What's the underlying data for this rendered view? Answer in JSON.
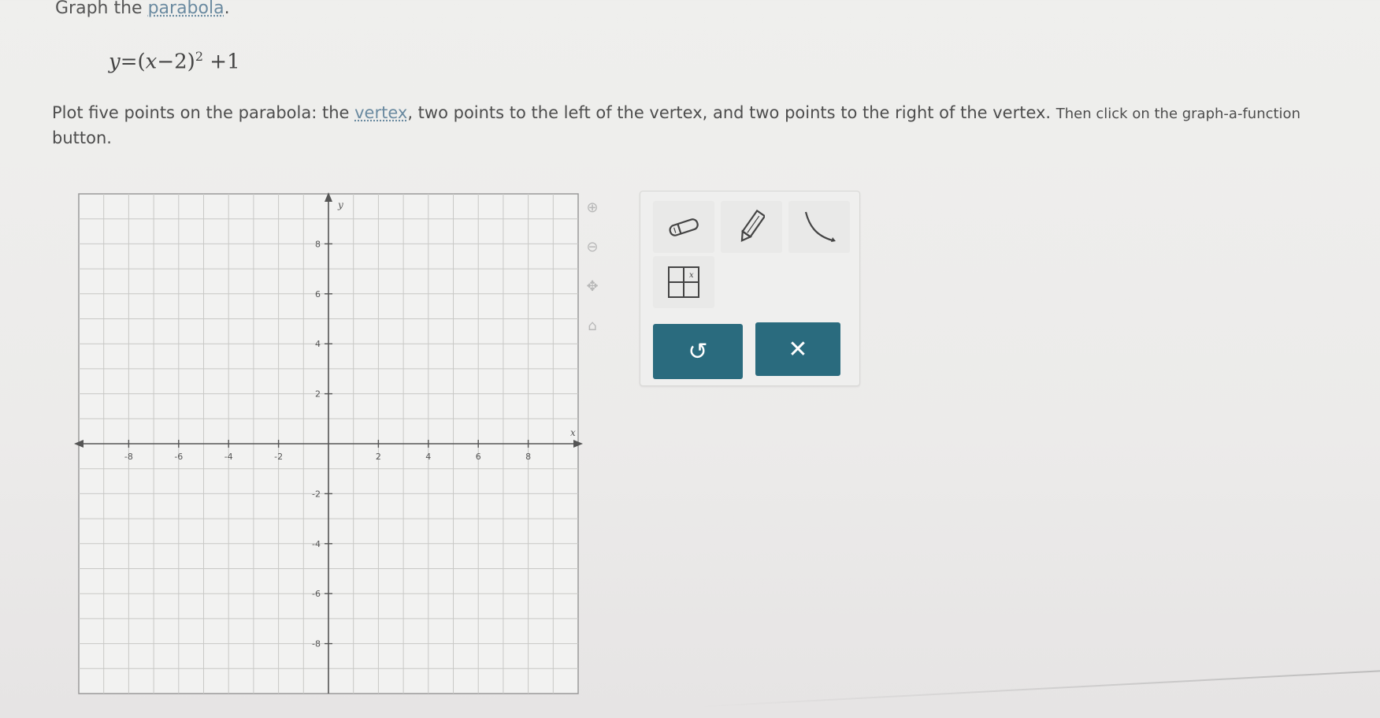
{
  "header": {
    "title_prefix": "Graph the ",
    "title_link": "parabola",
    "title_suffix": "."
  },
  "equation": {
    "lhs": "y",
    "eq": "=",
    "open": "(",
    "var": "x",
    "minus": "−",
    "two": "2",
    "close": ")",
    "exp": "2",
    "plus": "+",
    "one": "1"
  },
  "instructions": {
    "part1": "Plot five points on the parabola: the ",
    "link": "vertex",
    "part2": ", two points to the left of the vertex, and two points to the right of the vertex. ",
    "part3": "Then click on the graph-a-function",
    "part4": "button."
  },
  "graph": {
    "x_axis_label": "x",
    "y_axis_label": "y",
    "xlim": [
      -10,
      10
    ],
    "ylim": [
      -10,
      10
    ],
    "x_ticks": [
      "-8",
      "-6",
      "-4",
      "-2",
      "2",
      "4",
      "6",
      "8"
    ],
    "y_ticks": [
      "8",
      "6",
      "4",
      "2",
      "-2",
      "-4",
      "-6",
      "-8"
    ],
    "grid_step": 1
  },
  "side_tools": [
    {
      "name": "zoom-in-icon",
      "glyph": "⊕"
    },
    {
      "name": "zoom-out-icon",
      "glyph": "⊖"
    },
    {
      "name": "move-icon",
      "glyph": "✥"
    },
    {
      "name": "reset-view-icon",
      "glyph": "⌂"
    }
  ],
  "tools": {
    "eraser": "eraser-icon",
    "pencil": "pencil-icon",
    "graph_function": "graph-function-icon",
    "table": "table-icon"
  },
  "actions": {
    "undo_glyph": "↺",
    "clear_glyph": "✕"
  },
  "colors": {
    "accent": "#2a6b7e",
    "grid": "#c8c8c6",
    "axis": "#555555"
  }
}
